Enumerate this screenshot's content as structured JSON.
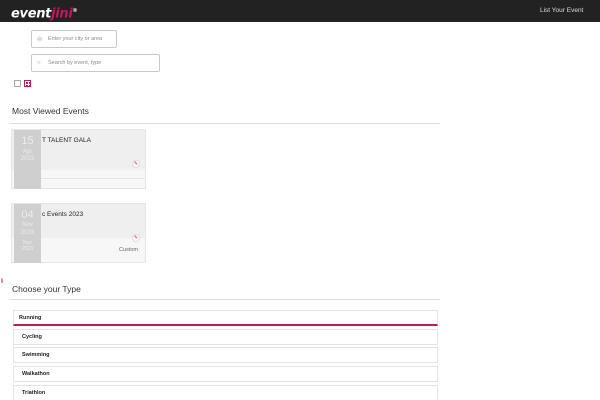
{
  "header": {
    "logo_main": "event",
    "logo_accent": "jini",
    "logo_mark": "®",
    "list_event_label": "List Your Event"
  },
  "search": {
    "city_placeholder": "Enter your city or area",
    "event_placeholder": "Search by event, type"
  },
  "view_toggle": [
    "list-view-icon",
    "grid-view-icon"
  ],
  "most_viewed": {
    "title": "Most Viewed Events",
    "events": [
      {
        "name": "T TALENT GALA",
        "day": "15",
        "month": "Apr",
        "year": "2023",
        "extra": "",
        "tag": ""
      },
      {
        "name": "c Events 2023",
        "day": "04",
        "month": "Nov",
        "year": "2023",
        "extra": "Nov 2023",
        "tag": "Custom"
      }
    ]
  },
  "side_marker": "ǁ",
  "choose_type": {
    "title": "Choose your Type",
    "types": [
      "Running",
      "Cycling",
      "Swimming",
      "Walkathon",
      "Triathlon"
    ],
    "selected": "Running"
  },
  "colors": {
    "accent": "#c2185b",
    "header_bg": "#222222"
  }
}
